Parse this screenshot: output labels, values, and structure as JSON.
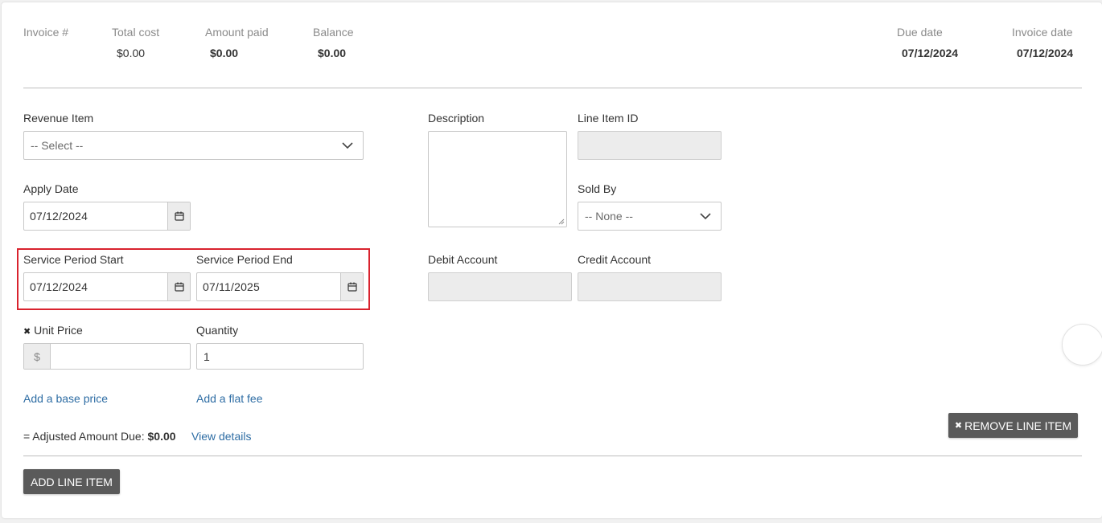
{
  "summary": {
    "invoice_number_label": "Invoice #",
    "total_cost_label": "Total cost",
    "total_cost_value": "$0.00",
    "amount_paid_label": "Amount paid",
    "amount_paid_value": "$0.00",
    "balance_label": "Balance",
    "balance_value": "$0.00",
    "due_date_label": "Due date",
    "due_date_value": "07/12/2024",
    "invoice_date_label": "Invoice date",
    "invoice_date_value": "07/12/2024"
  },
  "form": {
    "revenue_item": {
      "label": "Revenue Item",
      "selected": "-- Select --"
    },
    "apply_date": {
      "label": "Apply Date",
      "value": "07/12/2024"
    },
    "service_period_start": {
      "label": "Service Period Start",
      "value": "07/12/2024"
    },
    "service_period_end": {
      "label": "Service Period End",
      "value": "07/11/2025"
    },
    "unit_price": {
      "required_mark": "✖",
      "label": "Unit Price",
      "prefix": "$",
      "value": ""
    },
    "quantity": {
      "label": "Quantity",
      "value": "1"
    },
    "add_base_price_link": "Add a base price",
    "add_flat_fee_link": "Add a flat fee",
    "adjusted_amount": {
      "prefix": "= Adjusted Amount Due:",
      "value": "$0.00"
    },
    "view_details_link": "View details",
    "description": {
      "label": "Description",
      "value": ""
    },
    "line_item_id": {
      "label": "Line Item ID",
      "value": ""
    },
    "sold_by": {
      "label": "Sold By",
      "selected": "-- None --"
    },
    "debit_account": {
      "label": "Debit Account",
      "value": ""
    },
    "credit_account": {
      "label": "Credit Account",
      "value": ""
    }
  },
  "buttons": {
    "remove_line_item": {
      "icon": "✖",
      "label": "REMOVE LINE ITEM"
    },
    "add_line_item": "ADD LINE ITEM"
  },
  "colors": {
    "highlight": "#d9232e",
    "link": "#2e6da4",
    "button_dark": "#5a5a5a"
  }
}
